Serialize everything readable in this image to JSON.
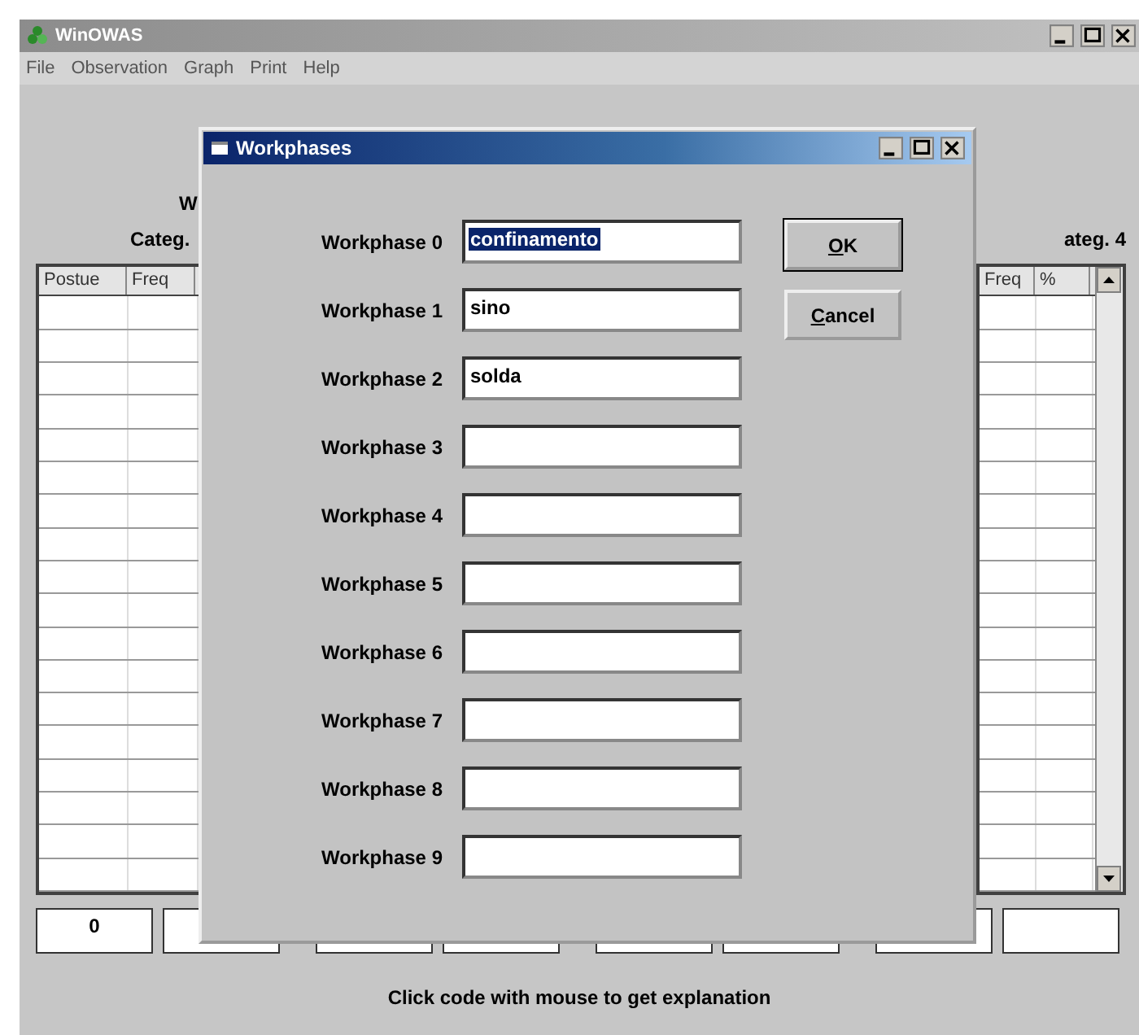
{
  "window": {
    "title": "WinOWAS",
    "menu": [
      "File",
      "Observation",
      "Graph",
      "Print",
      "Help"
    ]
  },
  "main": {
    "heading_fragment": "W",
    "left_category": "Categ.",
    "right_category": "ateg. 4",
    "left_table": {
      "columns": [
        "Postue",
        "Freq"
      ]
    },
    "right_table": {
      "columns": [
        "Freq",
        "%"
      ]
    },
    "code_boxes": [
      "0"
    ],
    "status": "Click code with mouse to get explanation"
  },
  "dialog": {
    "title": "Workphases",
    "fields": [
      {
        "label": "Workphase 0",
        "value": "confinamento",
        "selected": true
      },
      {
        "label": "Workphase 1",
        "value": "sino",
        "selected": false
      },
      {
        "label": "Workphase 2",
        "value": "solda",
        "selected": false
      },
      {
        "label": "Workphase 3",
        "selected": false
      },
      {
        "label": "Workphase 4",
        "selected": false
      },
      {
        "label": "Workphase 5",
        "selected": false
      },
      {
        "label": "Workphase 6",
        "selected": false
      },
      {
        "label": "Workphase 7",
        "selected": false
      },
      {
        "label": "Workphase 8",
        "selected": false
      },
      {
        "label": "Workphase 9",
        "selected": false
      }
    ],
    "buttons": [
      {
        "label": "OK",
        "kind": "default"
      },
      {
        "label": "Cancel",
        "kind": "normal"
      }
    ]
  }
}
